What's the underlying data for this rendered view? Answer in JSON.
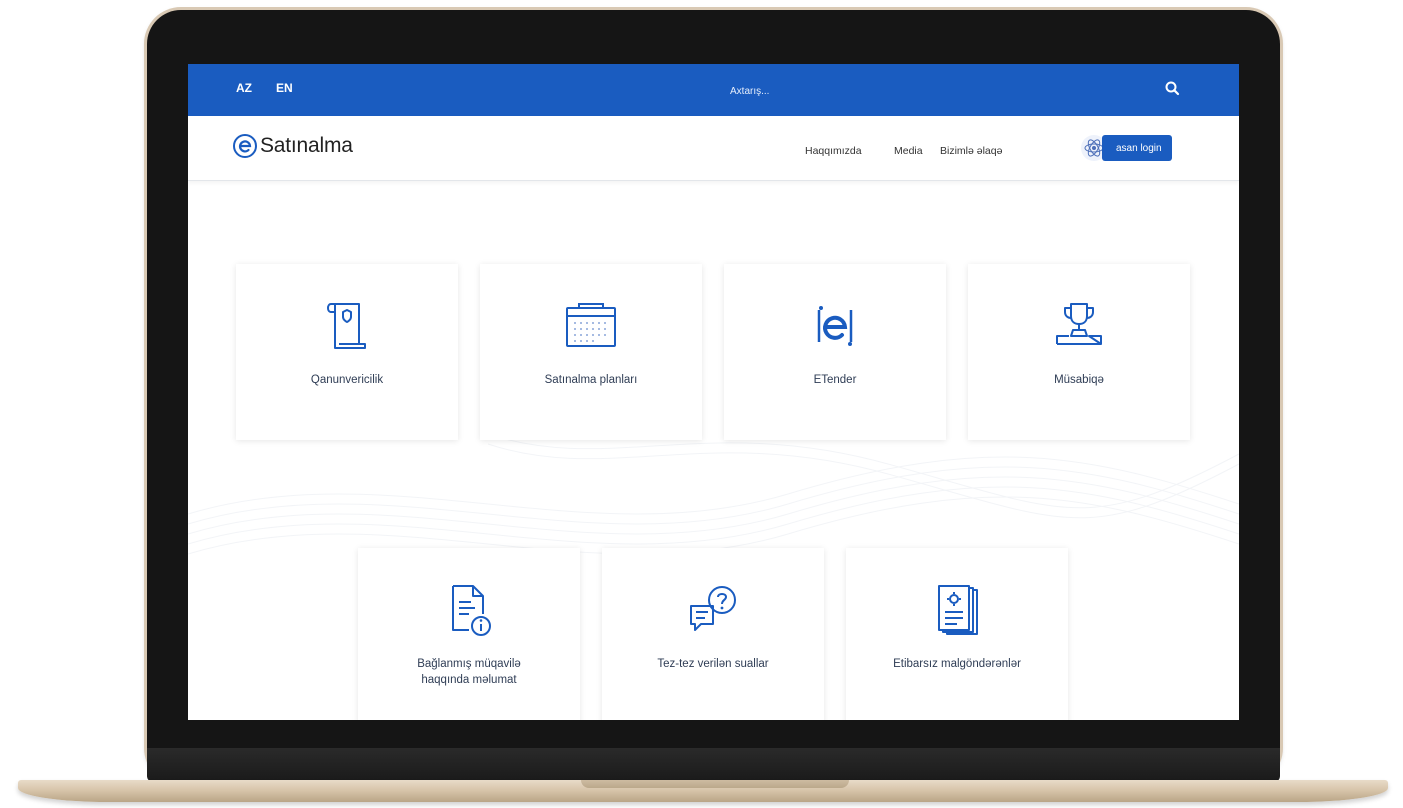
{
  "topbar": {
    "languages": [
      "AZ",
      "EN"
    ],
    "search_placeholder": "Axtarış..."
  },
  "header": {
    "logo_text": "Satınalma",
    "nav": [
      "Haqqımızda",
      "Media",
      "Bizimlə əlaqə"
    ],
    "login_label": "asan login"
  },
  "cards": [
    {
      "label": "Qanunvericilik",
      "icon": "law-scroll-icon"
    },
    {
      "label": "Satınalma planları",
      "icon": "calendar-icon"
    },
    {
      "label": "ETender",
      "icon": "etender-logo-icon"
    },
    {
      "label": "Müsabiqə",
      "icon": "trophy-icon"
    },
    {
      "label_line1": "Bağlanmış müqavilə",
      "label_line2": "haqqında məlumat",
      "icon": "document-info-icon"
    },
    {
      "label": "Tez-tez verilən suallar",
      "icon": "faq-chat-icon"
    },
    {
      "label": "Etibarsız malgöndərənlər",
      "icon": "blacklist-book-icon"
    }
  ],
  "colors": {
    "primary": "#1a5cc0",
    "icon": "#1a5cc0",
    "text": "#2f3d55"
  }
}
